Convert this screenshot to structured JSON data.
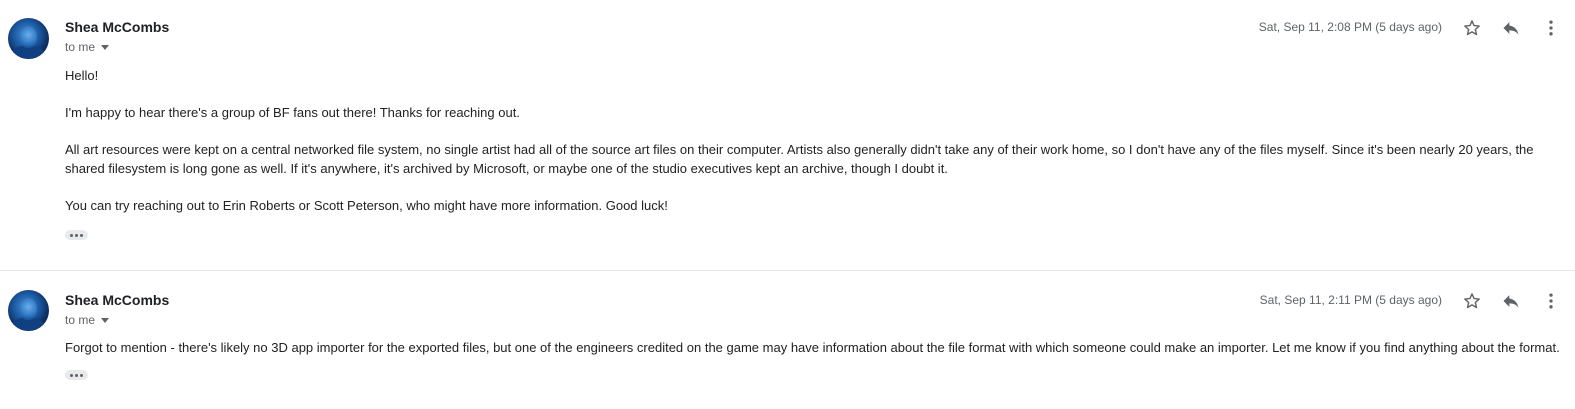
{
  "messages": [
    {
      "sender": "Shea McCombs",
      "recipient_label": "to me",
      "date": "Sat, Sep 11, 2:08 PM (5 days ago)",
      "paragraphs": [
        "Hello!",
        "I'm happy to hear there's a group of BF fans out there! Thanks for reaching out.",
        "All art resources were kept on a central networked file system, no single artist had all of the source art files on their computer. Artists also generally didn't take any of their work home, so I don't have any of the files myself. Since it's been nearly 20 years, the shared filesystem is long gone as well. If it's anywhere, it's archived by Microsoft, or maybe one of the studio executives kept an archive, though I doubt it.",
        "You can try reaching out to Erin Roberts or Scott Peterson, who might have more information. Good luck!"
      ]
    },
    {
      "sender": "Shea McCombs",
      "recipient_label": "to me",
      "date": "Sat, Sep 11, 2:11 PM (5 days ago)",
      "paragraphs": [
        "Forgot to mention - there's likely no 3D app importer for the exported files, but one of the engineers credited on the game may have information about the file format with which someone could make an importer. Let me know if you find anything about the format."
      ]
    }
  ],
  "icons": {
    "star": "star-outline-icon",
    "reply": "reply-arrow-icon",
    "more": "vertical-dots-icon",
    "ellipsis": "show-trimmed-content-icon"
  },
  "colors": {
    "text": "#222222",
    "muted": "#5f6368",
    "divider": "#e8e8e8"
  }
}
